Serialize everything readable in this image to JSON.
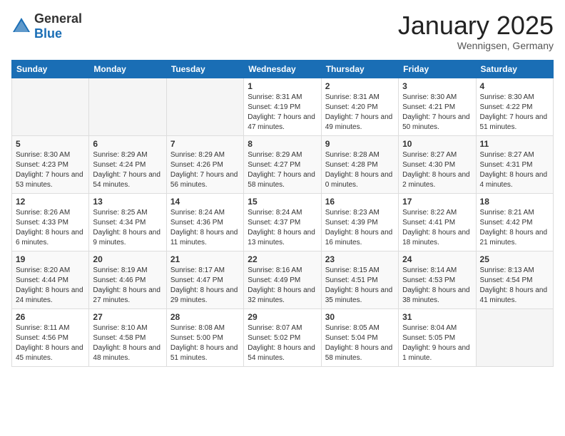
{
  "header": {
    "logo_general": "General",
    "logo_blue": "Blue",
    "month": "January 2025",
    "location": "Wennigsen, Germany"
  },
  "weekdays": [
    "Sunday",
    "Monday",
    "Tuesday",
    "Wednesday",
    "Thursday",
    "Friday",
    "Saturday"
  ],
  "weeks": [
    [
      {
        "day": "",
        "info": ""
      },
      {
        "day": "",
        "info": ""
      },
      {
        "day": "",
        "info": ""
      },
      {
        "day": "1",
        "info": "Sunrise: 8:31 AM\nSunset: 4:19 PM\nDaylight: 7 hours and 47 minutes."
      },
      {
        "day": "2",
        "info": "Sunrise: 8:31 AM\nSunset: 4:20 PM\nDaylight: 7 hours and 49 minutes."
      },
      {
        "day": "3",
        "info": "Sunrise: 8:30 AM\nSunset: 4:21 PM\nDaylight: 7 hours and 50 minutes."
      },
      {
        "day": "4",
        "info": "Sunrise: 8:30 AM\nSunset: 4:22 PM\nDaylight: 7 hours and 51 minutes."
      }
    ],
    [
      {
        "day": "5",
        "info": "Sunrise: 8:30 AM\nSunset: 4:23 PM\nDaylight: 7 hours and 53 minutes."
      },
      {
        "day": "6",
        "info": "Sunrise: 8:29 AM\nSunset: 4:24 PM\nDaylight: 7 hours and 54 minutes."
      },
      {
        "day": "7",
        "info": "Sunrise: 8:29 AM\nSunset: 4:26 PM\nDaylight: 7 hours and 56 minutes."
      },
      {
        "day": "8",
        "info": "Sunrise: 8:29 AM\nSunset: 4:27 PM\nDaylight: 7 hours and 58 minutes."
      },
      {
        "day": "9",
        "info": "Sunrise: 8:28 AM\nSunset: 4:28 PM\nDaylight: 8 hours and 0 minutes."
      },
      {
        "day": "10",
        "info": "Sunrise: 8:27 AM\nSunset: 4:30 PM\nDaylight: 8 hours and 2 minutes."
      },
      {
        "day": "11",
        "info": "Sunrise: 8:27 AM\nSunset: 4:31 PM\nDaylight: 8 hours and 4 minutes."
      }
    ],
    [
      {
        "day": "12",
        "info": "Sunrise: 8:26 AM\nSunset: 4:33 PM\nDaylight: 8 hours and 6 minutes."
      },
      {
        "day": "13",
        "info": "Sunrise: 8:25 AM\nSunset: 4:34 PM\nDaylight: 8 hours and 9 minutes."
      },
      {
        "day": "14",
        "info": "Sunrise: 8:24 AM\nSunset: 4:36 PM\nDaylight: 8 hours and 11 minutes."
      },
      {
        "day": "15",
        "info": "Sunrise: 8:24 AM\nSunset: 4:37 PM\nDaylight: 8 hours and 13 minutes."
      },
      {
        "day": "16",
        "info": "Sunrise: 8:23 AM\nSunset: 4:39 PM\nDaylight: 8 hours and 16 minutes."
      },
      {
        "day": "17",
        "info": "Sunrise: 8:22 AM\nSunset: 4:41 PM\nDaylight: 8 hours and 18 minutes."
      },
      {
        "day": "18",
        "info": "Sunrise: 8:21 AM\nSunset: 4:42 PM\nDaylight: 8 hours and 21 minutes."
      }
    ],
    [
      {
        "day": "19",
        "info": "Sunrise: 8:20 AM\nSunset: 4:44 PM\nDaylight: 8 hours and 24 minutes."
      },
      {
        "day": "20",
        "info": "Sunrise: 8:19 AM\nSunset: 4:46 PM\nDaylight: 8 hours and 27 minutes."
      },
      {
        "day": "21",
        "info": "Sunrise: 8:17 AM\nSunset: 4:47 PM\nDaylight: 8 hours and 29 minutes."
      },
      {
        "day": "22",
        "info": "Sunrise: 8:16 AM\nSunset: 4:49 PM\nDaylight: 8 hours and 32 minutes."
      },
      {
        "day": "23",
        "info": "Sunrise: 8:15 AM\nSunset: 4:51 PM\nDaylight: 8 hours and 35 minutes."
      },
      {
        "day": "24",
        "info": "Sunrise: 8:14 AM\nSunset: 4:53 PM\nDaylight: 8 hours and 38 minutes."
      },
      {
        "day": "25",
        "info": "Sunrise: 8:13 AM\nSunset: 4:54 PM\nDaylight: 8 hours and 41 minutes."
      }
    ],
    [
      {
        "day": "26",
        "info": "Sunrise: 8:11 AM\nSunset: 4:56 PM\nDaylight: 8 hours and 45 minutes."
      },
      {
        "day": "27",
        "info": "Sunrise: 8:10 AM\nSunset: 4:58 PM\nDaylight: 8 hours and 48 minutes."
      },
      {
        "day": "28",
        "info": "Sunrise: 8:08 AM\nSunset: 5:00 PM\nDaylight: 8 hours and 51 minutes."
      },
      {
        "day": "29",
        "info": "Sunrise: 8:07 AM\nSunset: 5:02 PM\nDaylight: 8 hours and 54 minutes."
      },
      {
        "day": "30",
        "info": "Sunrise: 8:05 AM\nSunset: 5:04 PM\nDaylight: 8 hours and 58 minutes."
      },
      {
        "day": "31",
        "info": "Sunrise: 8:04 AM\nSunset: 5:05 PM\nDaylight: 9 hours and 1 minute."
      },
      {
        "day": "",
        "info": ""
      }
    ]
  ]
}
